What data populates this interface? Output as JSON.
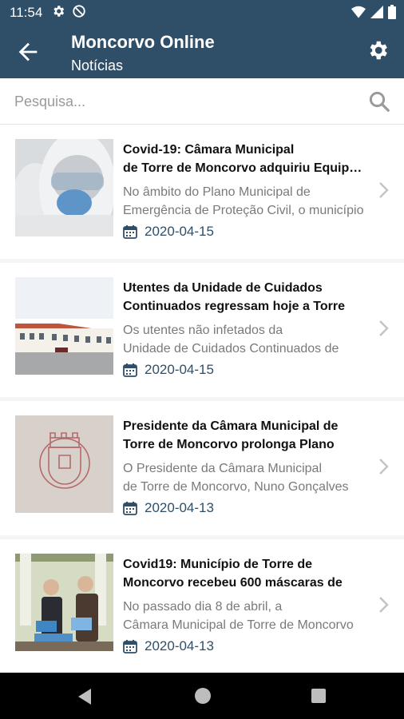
{
  "status_bar": {
    "time": "11:54",
    "icons": [
      "settings-icon",
      "no-sim-icon",
      "wifi-icon",
      "signal-icon",
      "battery-icon"
    ]
  },
  "app_bar": {
    "title": "Moncorvo Online",
    "subtitle": "Notícias",
    "back_icon": "arrow-back-icon",
    "settings_icon": "gear-icon"
  },
  "search": {
    "placeholder": "Pesquisa...",
    "value": "",
    "icon": "search-icon"
  },
  "colors": {
    "primary": "#2f4f69",
    "date": "#2f4f69",
    "summary": "#7a7a7a",
    "title": "#111111",
    "background": "#f5f5f5"
  },
  "news": [
    {
      "title_line1": "Covid-19: Câmara Municipal",
      "title_line2": "de Torre de Moncorvo adquiriu Equipamentos",
      "summary_line1": "No âmbito do Plano Municipal de",
      "summary_line2": "Emergência de Proteção Civil, o município",
      "date": "2020-04-15",
      "image": "medical-worker-mask-photo"
    },
    {
      "title_line1": "Utentes da Unidade de Cuidados",
      "title_line2": "Continuados regressam hoje a Torre",
      "summary_line1": "Os utentes não infetados da",
      "summary_line2": "Unidade de Cuidados Continuados de",
      "date": "2020-04-15",
      "image": "building-photo"
    },
    {
      "title_line1": "Presidente da Câmara Municipal de",
      "title_line2": "Torre de Moncorvo prolonga Plano",
      "summary_line1": "O Presidente da Câmara Municipal",
      "summary_line2": "de Torre de Moncorvo, Nuno Gonçalves",
      "date": "2020-04-13",
      "image": "municipal-coat-of-arms"
    },
    {
      "title_line1": "Covid19: Município de Torre de",
      "title_line2": "Moncorvo recebeu 600 máscaras de",
      "summary_line1": "No passado dia 8 de abril, a",
      "summary_line2": "Câmara Municipal de Torre de Moncorvo",
      "date": "2020-04-13",
      "image": "people-with-masks-photo"
    }
  ],
  "nav_bar": {
    "back": "nav-back-icon",
    "home": "nav-home-icon",
    "recents": "nav-recents-icon"
  }
}
